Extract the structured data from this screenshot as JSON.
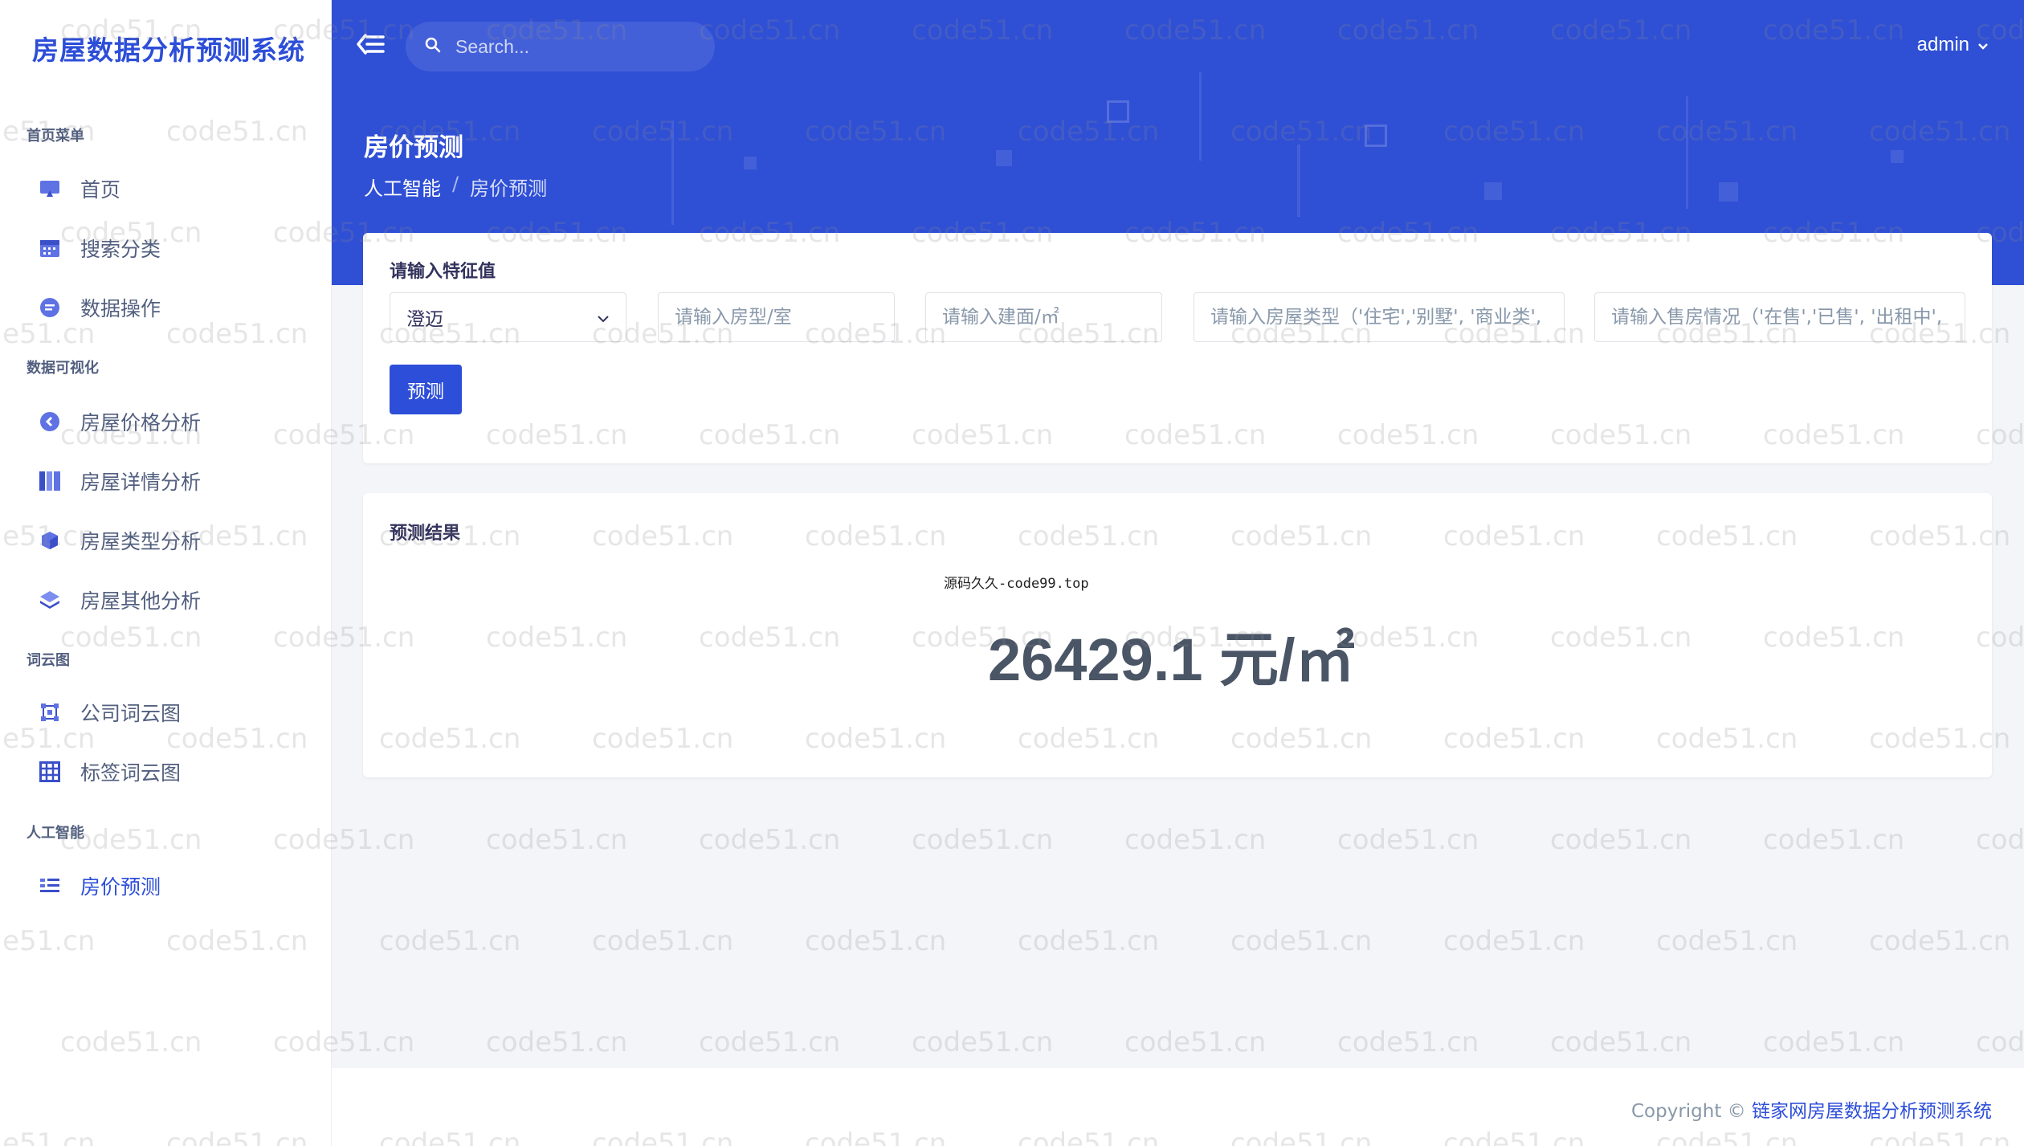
{
  "sidebar": {
    "brand": "房屋数据分析预测系统",
    "sections": [
      {
        "heading": "首页菜单",
        "items": [
          {
            "label": "首页",
            "icon": "monitor-icon"
          },
          {
            "label": "搜索分类",
            "icon": "calendar-icon"
          },
          {
            "label": "数据操作",
            "icon": "chat-icon"
          }
        ]
      },
      {
        "heading": "数据可视化",
        "items": [
          {
            "label": "房屋价格分析",
            "icon": "back-circle-icon"
          },
          {
            "label": "房屋详情分析",
            "icon": "columns-icon"
          },
          {
            "label": "房屋类型分析",
            "icon": "cube-icon"
          },
          {
            "label": "房屋其他分析",
            "icon": "layers-icon"
          }
        ]
      },
      {
        "heading": "词云图",
        "items": [
          {
            "label": "公司词云图",
            "icon": "nodes-icon"
          },
          {
            "label": "标签词云图",
            "icon": "grid-icon"
          }
        ]
      },
      {
        "heading": "人工智能",
        "items": [
          {
            "label": "房价预测",
            "icon": "list-icon",
            "active": true
          }
        ]
      }
    ]
  },
  "header": {
    "search_placeholder": "Search...",
    "user": "admin",
    "page_title": "房价预测",
    "breadcrumb": [
      "人工智能",
      "房价预测"
    ],
    "breadcrumb_sep": "/"
  },
  "form": {
    "title": "请输入特征值",
    "district_selected": "澄迈",
    "room_placeholder": "请输入房型/室",
    "area_placeholder": "请输入建面/㎡",
    "type_placeholder": "请输入房屋类型（'住宅','别墅', '商业类',",
    "status_placeholder": "请输入售房情况（'在售','已售', '出租中',",
    "submit_label": "预测"
  },
  "result": {
    "title": "预测结果",
    "note": "源码久久-code99.top",
    "value": "26429.1 元/㎡"
  },
  "footer": {
    "prefix": "Copyright ©",
    "link": "链家网房屋数据分析预测系统"
  },
  "watermark": "code51.cn",
  "colors": {
    "accent": "#2d4ed8",
    "header_bg": "#2f4fd5",
    "page_bg": "#f4f5f8"
  }
}
